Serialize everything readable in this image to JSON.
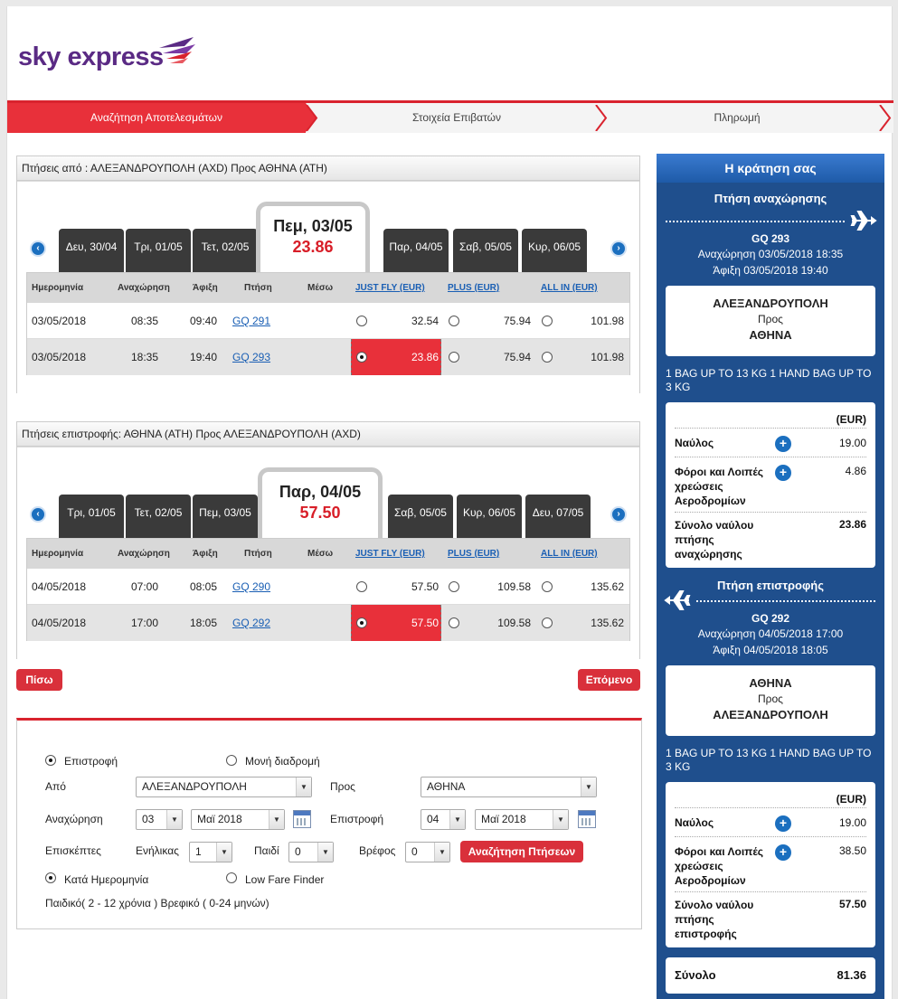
{
  "brand": {
    "name": "sky express"
  },
  "steps": [
    {
      "label": "Αναζήτηση Αποτελεσμάτων"
    },
    {
      "label": "Στοιχεία Επιβατών"
    },
    {
      "label": "Πληρωμή"
    }
  ],
  "outbound": {
    "title": "Πτήσεις από : ΑΛΕΞΑΝΔΡΟΥΠΟΛΗ (AXD)  Προς  ΑΘΗΝΑ (ATH)",
    "tabs": [
      "Δευ, 30/04",
      "Τρι, 01/05",
      "Τετ, 02/05",
      "Παρ, 04/05",
      "Σαβ, 05/05",
      "Κυρ, 06/05"
    ],
    "active": {
      "date": "Πεμ, 03/05",
      "price": "23.86"
    },
    "rows": [
      {
        "date": "03/05/2018",
        "dep": "08:35",
        "arr": "09:40",
        "flight": "GQ 291",
        "via": "",
        "jf": "32.54",
        "plus": "75.94",
        "allin": "101.98",
        "selected": false
      },
      {
        "date": "03/05/2018",
        "dep": "18:35",
        "arr": "19:40",
        "flight": "GQ 293",
        "via": "",
        "jf": "23.86",
        "plus": "75.94",
        "allin": "101.98",
        "selected": true
      }
    ]
  },
  "inbound": {
    "title": "Πτήσεις επιστροφής: ΑΘΗΝΑ (ATH)  Προς  ΑΛΕΞΑΝΔΡΟΥΠΟΛΗ (AXD)",
    "tabs": [
      "Τρι, 01/05",
      "Τετ, 02/05",
      "Πεμ, 03/05",
      "Σαβ, 05/05",
      "Κυρ, 06/05",
      "Δευ, 07/05"
    ],
    "active": {
      "date": "Παρ, 04/05",
      "price": "57.50"
    },
    "rows": [
      {
        "date": "04/05/2018",
        "dep": "07:00",
        "arr": "08:05",
        "flight": "GQ 290",
        "via": "",
        "jf": "57.50",
        "plus": "109.58",
        "allin": "135.62",
        "selected": false
      },
      {
        "date": "04/05/2018",
        "dep": "17:00",
        "arr": "18:05",
        "flight": "GQ 292",
        "via": "",
        "jf": "57.50",
        "plus": "109.58",
        "allin": "135.62",
        "selected": true
      }
    ]
  },
  "columns": {
    "date": "Ημερομηνία",
    "dep": "Αναχώρηση",
    "arr": "Άφιξη",
    "flight": "Πτήση",
    "via": "Μέσω",
    "jf": "JUST FLY (EUR)",
    "plus": "PLUS (EUR)",
    "allin": "ALL IN (EUR)"
  },
  "buttons": {
    "back": "Πίσω",
    "next": "Επόμενο",
    "search": "Αναζήτηση Πτήσεων"
  },
  "form": {
    "trip_return": "Επιστροφή",
    "trip_oneway": "Μονή διαδρομή",
    "from_label": "Από",
    "from_value": "ΑΛΕΞΑΝΔΡΟΥΠΟΛΗ",
    "to_label": "Προς",
    "to_value": "ΑΘΗΝΑ",
    "dep_label": "Αναχώρηση",
    "dep_day": "03",
    "dep_month": "Μαϊ 2018",
    "ret_label": "Επιστροφή",
    "ret_day": "04",
    "ret_month": "Μαϊ 2018",
    "visitors": "Επισκέπτες",
    "adult": "Ενήλικας",
    "adult_val": "1",
    "child": "Παιδί",
    "child_val": "0",
    "infant": "Βρέφος",
    "infant_val": "0",
    "by_date": "Κατά Ημερομηνία",
    "low_fare": "Low Fare Finder",
    "note": "Παιδικό( 2 - 12 χρόνια ) Βρεφικό ( 0-24 μηνών)"
  },
  "summary": {
    "header": "Η κράτηση σας",
    "out": {
      "title": "Πτήση αναχώρησης",
      "flight": "GQ 293",
      "dep": "Αναχώρηση  03/05/2018  18:35",
      "arr": "Άφιξη  03/05/2018  19:40",
      "from": "ΑΛΕΞΑΝΔΡΟΥΠΟΛΗ",
      "to_word": "Προς",
      "to": "ΑΘΗΝΑ",
      "bag": "1 BAG UP TO 13 KG 1 HAND BAG UP TO 3 KG",
      "cur": "(EUR)",
      "fare_label": "Ναύλος",
      "fare": "19.00",
      "tax_label": "Φόροι και Λοιπές χρεώσεις Αεροδρομίων",
      "tax": "4.86",
      "total_label": "Σύνολο ναύλου πτήσης αναχώρησης",
      "total": "23.86"
    },
    "ret": {
      "title": "Πτήση επιστροφής",
      "flight": "GQ 292",
      "dep": "Αναχώρηση  04/05/2018  17:00",
      "arr": "Άφιξη  04/05/2018  18:05",
      "from": "ΑΘΗΝΑ",
      "to_word": "Προς",
      "to": "ΑΛΕΞΑΝΔΡΟΥΠΟΛΗ",
      "bag": "1 BAG UP TO 13 KG 1 HAND BAG UP TO 3 KG",
      "cur": "(EUR)",
      "fare_label": "Ναύλος",
      "fare": "19.00",
      "tax_label": "Φόροι και Λοιπές χρεώσεις Αεροδρομίων",
      "tax": "38.50",
      "total_label": "Σύνολο ναύλου πτήσης επιστροφής",
      "total": "57.50"
    },
    "grand_label": "Σύνολο",
    "grand": "81.36"
  }
}
